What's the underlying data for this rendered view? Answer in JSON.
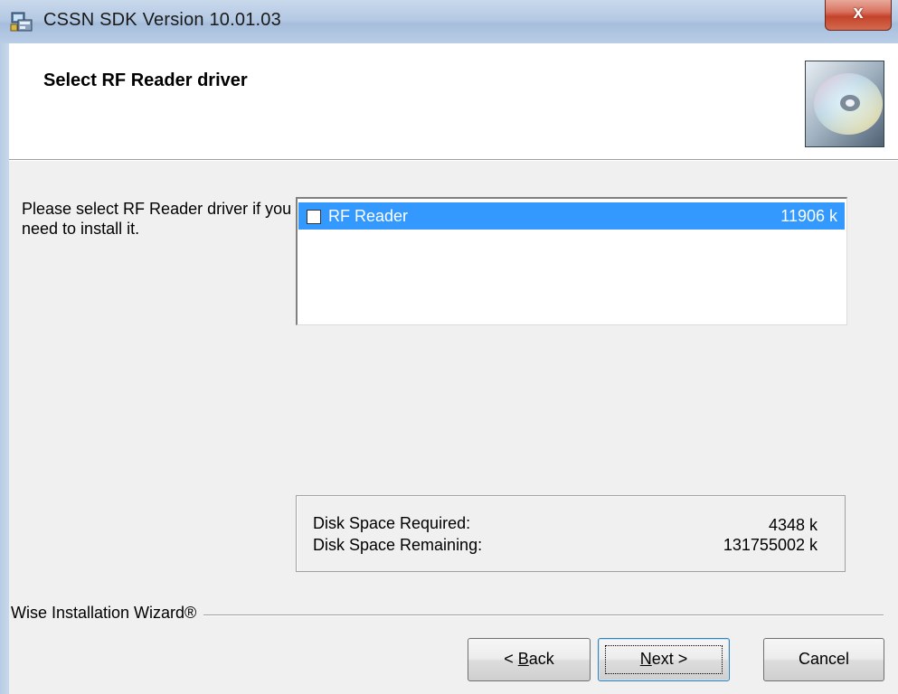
{
  "window": {
    "title": "CSSN SDK Version 10.01.03",
    "close_label": "x"
  },
  "header": {
    "title": "Select RF Reader driver",
    "icon": "cd-icon"
  },
  "instruction": {
    "text": "Please select RF Reader driver if you need to install it."
  },
  "components": {
    "items": [
      {
        "label": "RF Reader",
        "size": "11906 k",
        "checked": false,
        "selected": true
      }
    ]
  },
  "disk": {
    "required_label": "Disk Space Required:",
    "required_value": "4348 k",
    "remaining_label": "Disk Space Remaining:",
    "remaining_value": "131755002 k"
  },
  "footer": {
    "brand": "Wise Installation Wizard®"
  },
  "buttons": {
    "back_prefix": "< ",
    "back_accel": "B",
    "back_rest": "ack",
    "next_accel": "N",
    "next_rest": "ext >",
    "cancel": "Cancel"
  },
  "colors": {
    "selection": "#3399ff",
    "titlebar": "#b4c9e3",
    "close": "#c4432a"
  }
}
